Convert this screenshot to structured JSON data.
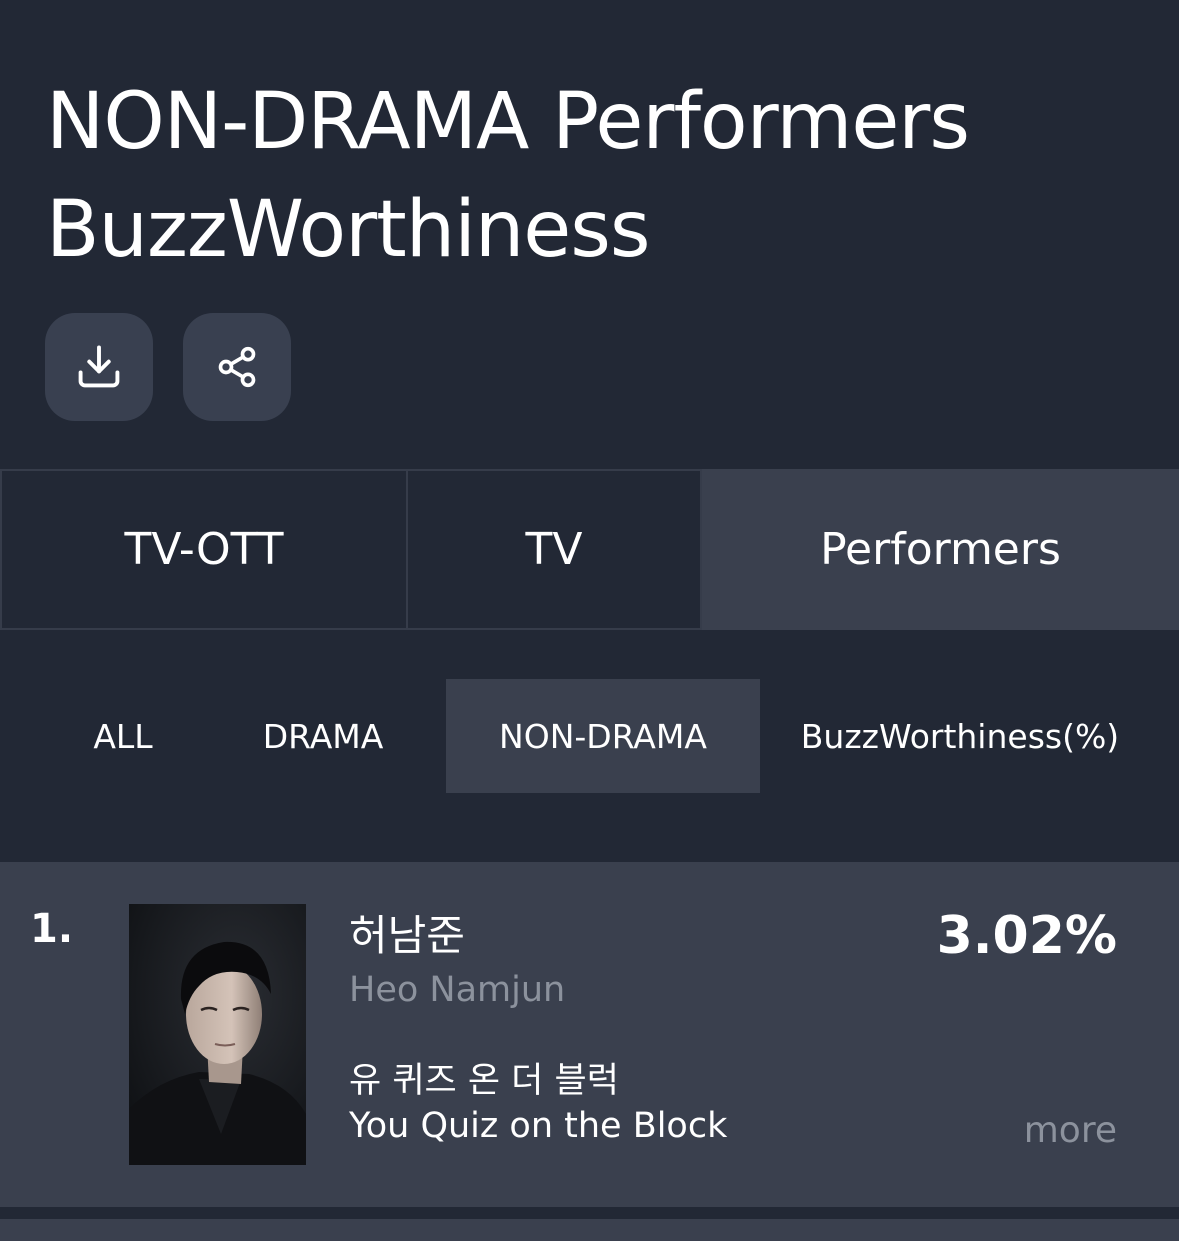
{
  "header": {
    "title_line1": "NON-DRAMA Performers",
    "title_line2": "BuzzWorthiness"
  },
  "actions": {
    "download_icon": "download-icon",
    "share_icon": "share-icon"
  },
  "tabs": [
    {
      "label": "TV-OTT",
      "selected": false
    },
    {
      "label": "TV",
      "selected": false
    },
    {
      "label": "Performers",
      "selected": true
    }
  ],
  "filters": [
    {
      "label": "ALL",
      "selected": false
    },
    {
      "label": "DRAMA",
      "selected": false
    },
    {
      "label": "NON-DRAMA",
      "selected": true
    },
    {
      "label": "BuzzWorthiness(%)",
      "selected": false
    }
  ],
  "rankings": [
    {
      "rank": "1.",
      "name_ko": "허남준",
      "name_en": "Heo Namjun",
      "show_ko": "유 퀴즈 온 더 블럭",
      "show_en": "You Quiz on the Block",
      "score": "3.02%",
      "more_label": "more"
    }
  ],
  "colors": {
    "background": "#222835",
    "selected_bg": "#3a404e",
    "muted_text": "#8c929d"
  }
}
